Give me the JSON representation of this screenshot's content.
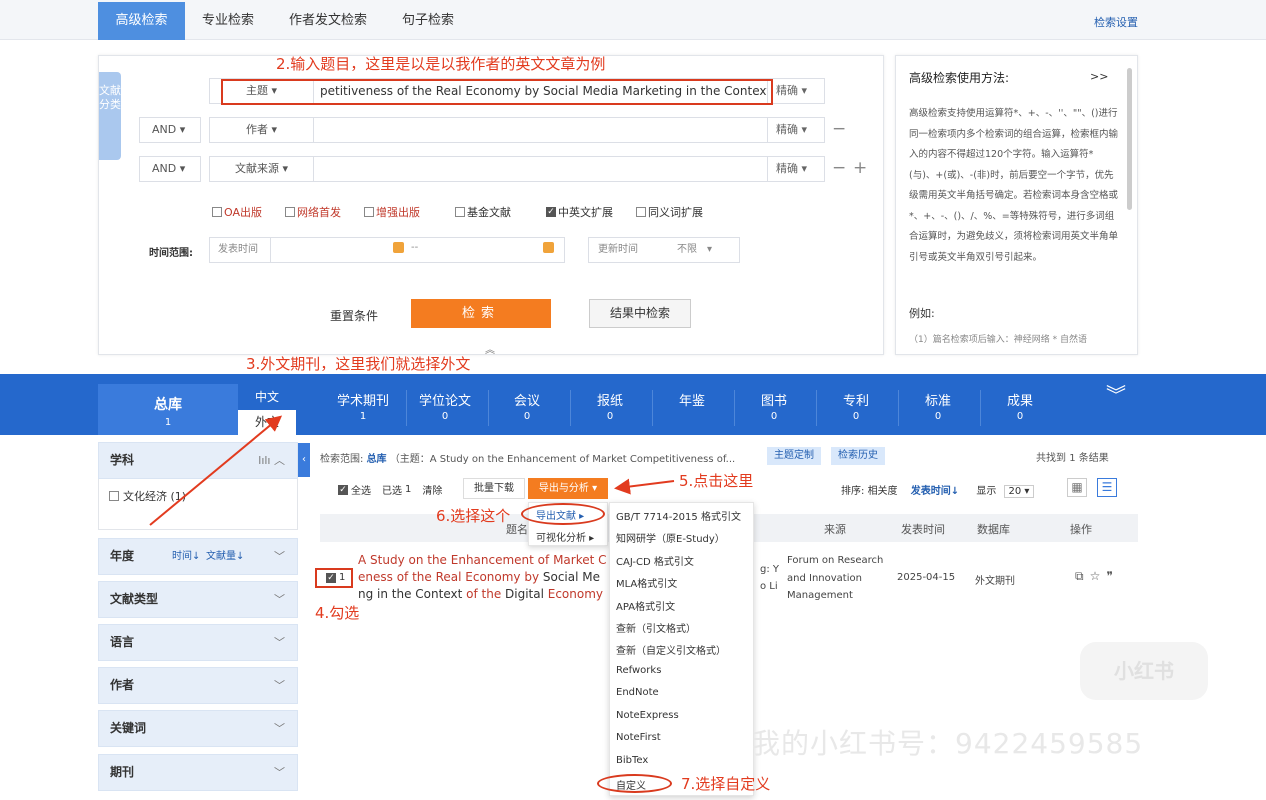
{
  "tabs": [
    "高级检索",
    "专业检索",
    "作者发文检索",
    "句子检索"
  ],
  "search_settings": "检索设置",
  "side_tab": "文献分类",
  "rows": [
    {
      "field": "主题",
      "value": "petitiveness of the Real Economy by Social Media Marketing in the Context of the",
      "match": "精确"
    },
    {
      "bool": "AND",
      "field": "作者",
      "value": "",
      "match": "精确"
    },
    {
      "bool": "AND",
      "field": "文献来源",
      "value": "",
      "match": "精确"
    }
  ],
  "options": [
    {
      "label": "OA出版",
      "checked": false,
      "red": true
    },
    {
      "label": "网络首发",
      "checked": false,
      "red": true
    },
    {
      "label": "增强出版",
      "checked": false,
      "red": true
    },
    {
      "label": "基金文献",
      "checked": false,
      "red": false
    },
    {
      "label": "中英文扩展",
      "checked": true,
      "red": false
    },
    {
      "label": "同义词扩展",
      "checked": false,
      "red": false
    }
  ],
  "time": {
    "label": "时间范围:",
    "publish": "发表时间",
    "sep": "--",
    "update": "更新时间",
    "update_val": "不限"
  },
  "buttons": {
    "reset": "重置条件",
    "search": "检索",
    "within": "结果中检索"
  },
  "help": {
    "title": "高级检索使用方法:",
    "more": ">>",
    "body": "高级检索支持使用运算符*、+、-、''、\"\"、()进行同一检索项内多个检索词的组合运算，检索框内输入的内容不得超过120个字符。输入运算符*(与)、+(或)、-(非)时，前后要空一个字节，优先级需用英文半角括号确定。若检索词本身含空格或*、+、-、()、/、%、=等特殊符号，进行多词组合运算时，为避免歧义，须将检索词用英文半角单引号或英文半角双引号引起来。",
    "eg": "例如:",
    "eg1": "（1）篇名检索项后输入：神经网络 * 自然语"
  },
  "bluebar": {
    "all": "总库",
    "all_n": "1",
    "zh": "中文",
    "wai": "外文",
    "cats": [
      {
        "name": "学术期刊",
        "n": "1"
      },
      {
        "name": "学位论文",
        "n": "0"
      },
      {
        "name": "会议",
        "n": "0"
      },
      {
        "name": "报纸",
        "n": "0"
      },
      {
        "name": "年鉴",
        "n": ""
      },
      {
        "name": "图书",
        "n": "0"
      },
      {
        "name": "专利",
        "n": "0"
      },
      {
        "name": "标准",
        "n": "0"
      },
      {
        "name": "成果",
        "n": "0"
      }
    ]
  },
  "facets": {
    "subject": "学科",
    "subject_item": "文化经济 (1)",
    "year": "年度",
    "year_sort1": "时间↓",
    "year_sort2": "文献量↓",
    "others": [
      "文献类型",
      "语言",
      "作者",
      "关键词",
      "期刊"
    ]
  },
  "results": {
    "scope_label": "检索范围:",
    "scope_val": "总库",
    "scope_query": "（主题：A Study on the Enhancement of Market Competitiveness of...",
    "tag1": "主题定制",
    "tag2": "检索历史",
    "found_prefix": "共找到",
    "found_n": "1",
    "found_suffix": "条结果",
    "select_all": "全选",
    "selected": "已选",
    "selected_n": "1",
    "clear": "清除",
    "batch": "批量下载",
    "export": "导出与分析 ▾",
    "sort_label": "排序:",
    "sort_rel": "相关度",
    "sort_date": "发表时间↓",
    "show_label": "显示",
    "show_n": "20",
    "headers": [
      "题名",
      "来源",
      "发表时间",
      "数据库",
      "操作"
    ],
    "row": {
      "idx": "1",
      "title_red": "A Study on the Enhancement of Market C",
      "title2_red": "eness of the Real Economy by",
      "title2_black": " Social Me",
      "title3_black": "ng in the Context ",
      "title3_red": "of the",
      "title3_black2": " Digital ",
      "title3_red2": "Economy",
      "author1": "g: Y",
      "author2": "o Li",
      "source": "Forum on Research and Innovation Management",
      "date": "2025-04-15",
      "db": "外文期刊"
    }
  },
  "menu1": [
    "导出文献 ▸",
    "可视化分析 ▸"
  ],
  "formats": [
    "GB/T 7714-2015 格式引文",
    "知网研学（原E-Study）",
    "CAJ-CD 格式引文",
    "MLA格式引文",
    "APA格式引文",
    "查新（引文格式）",
    "查新（自定义引文格式）",
    "Refworks",
    "EndNote",
    "NoteExpress",
    "NoteFirst",
    "BibTex",
    "自定义"
  ],
  "annotations": [
    "2.输入题目，这里是以是以我作者的英文文章为例",
    "3.外文期刊，这里我们就选择外文",
    "4.勾选",
    "5.点击这里",
    "6.选择这个",
    "7.选择自定义"
  ],
  "watermark": "我的小红书号：9422459585",
  "logo_watermark": "小红书",
  "colors": {
    "accent": "#2568cc",
    "orange": "#f47c20",
    "annotation": "#e23b1f"
  }
}
